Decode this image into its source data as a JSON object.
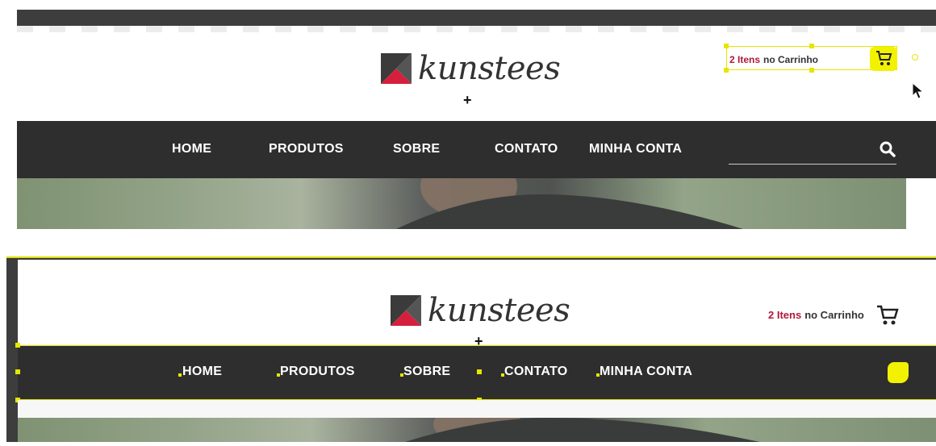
{
  "brand": {
    "name": "kunstees"
  },
  "cart": {
    "count": "2 Itens",
    "label": "no Carrinho"
  },
  "nav": {
    "items": [
      {
        "label": "HOME"
      },
      {
        "label": "PRODUTOS"
      },
      {
        "label": "SOBRE"
      },
      {
        "label": "CONTATO"
      },
      {
        "label": "MINHA CONTA"
      }
    ]
  },
  "icons": {
    "search": "search-icon",
    "cart": "shopping-cart-icon",
    "cursor": "mouse-pointer-icon",
    "crosshair": "crosshair-icon"
  },
  "colors": {
    "nav_background": "#2e2e2e",
    "cart_count": "#b0183c",
    "logo_gray": "#3b3b3b",
    "logo_red": "#d61f3c",
    "selection": "#e6e600"
  }
}
